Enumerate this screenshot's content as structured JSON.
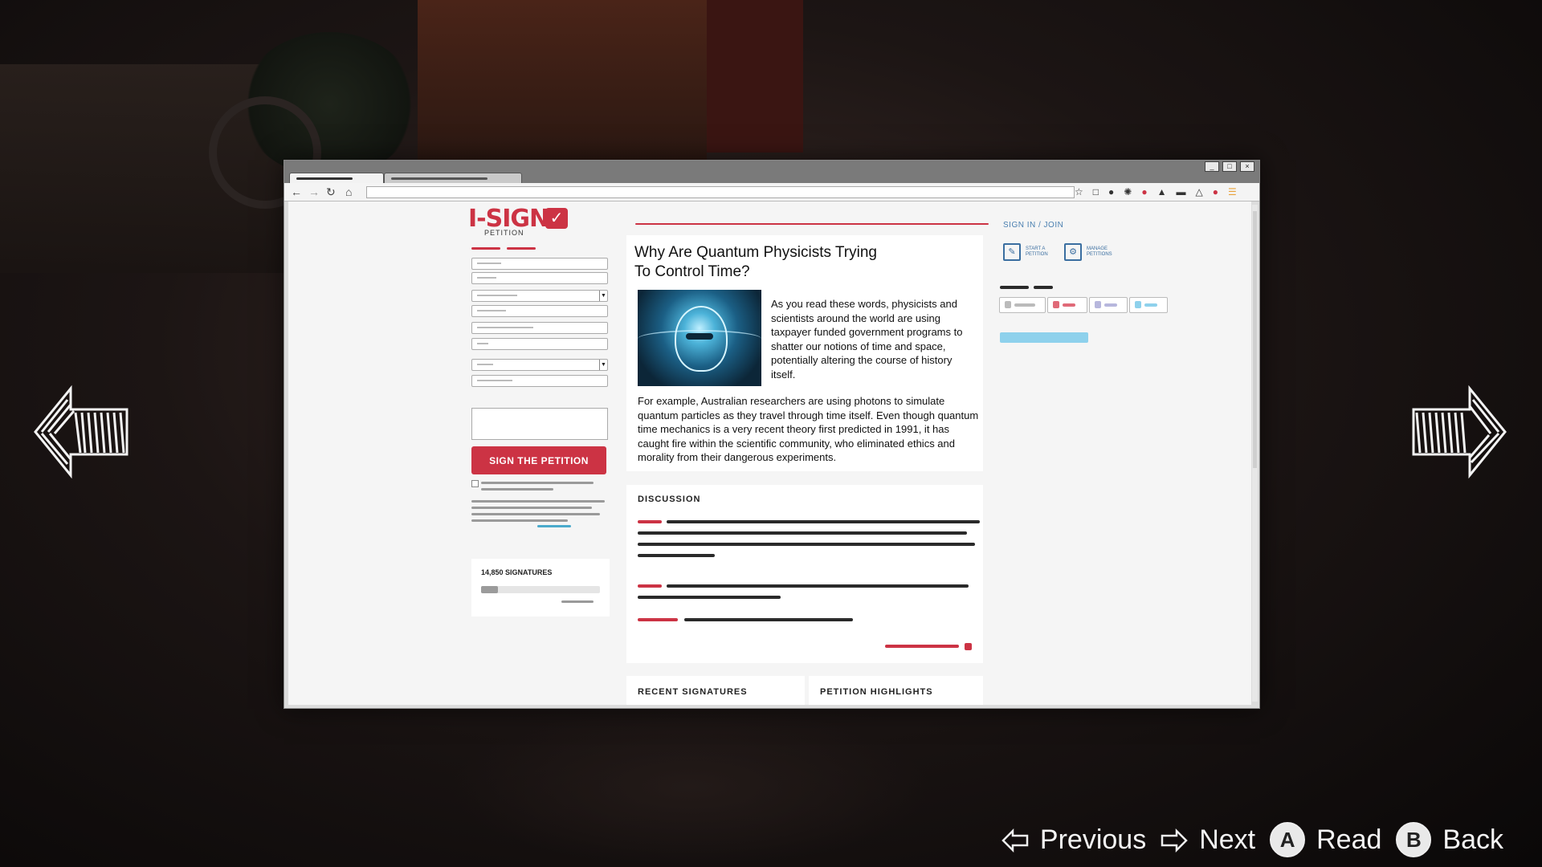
{
  "browser": {
    "window_buttons": [
      "_",
      "□",
      "×"
    ],
    "nav_icons": [
      "back-arrow",
      "forward-arrow",
      "reload",
      "home"
    ],
    "toolbar_icons": [
      "star",
      "square",
      "circle",
      "record",
      "pin",
      "puzzle",
      "chat",
      "triangle",
      "alert",
      "menu"
    ]
  },
  "site": {
    "logo": "I-SIGN",
    "logo_sub": "PETITION",
    "sign_button": "SIGN THE PETITION",
    "signatures_label": "14,850 SIGNATURES",
    "signatures_progress": 0.14,
    "sign_in": "SIGN IN / JOIN",
    "actions": [
      {
        "label": "START A PETITION",
        "icon": "pencil-icon"
      },
      {
        "label": "MANAGE PETITIONS",
        "icon": "gear-icon"
      }
    ]
  },
  "article": {
    "title": "Why Are Quantum Physicists Trying To Control Time?",
    "paragraph1": "As you read these words, physicists and scientists around the world are using taxpayer funded government programs to shatter our notions of time and space, potentially altering the course of history itself.",
    "paragraph2": "For example, Australian researchers are using photons to simulate quantum particles as they travel through time itself. Even though quantum time mechanics is a very recent theory first predicted in 1991, it has caught fire within the scientific community, who eliminated ethics and morality from their dangerous experiments."
  },
  "discussion": {
    "heading": "DISCUSSION"
  },
  "sections": {
    "recent_signatures": "RECENT SIGNATURES",
    "petition_highlights": "PETITION HIGHLIGHTS"
  },
  "footer": {
    "previous": "Previous",
    "next": "Next",
    "read": "Read",
    "read_button": "A",
    "back": "Back",
    "back_button": "B"
  },
  "colors": {
    "brand": "#cc3344",
    "link": "#4a7fb0",
    "accent": "#8ed1ec"
  }
}
